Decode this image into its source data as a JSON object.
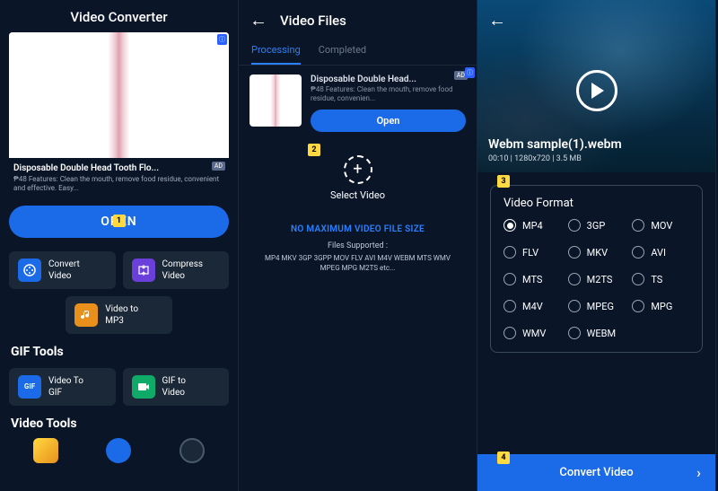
{
  "screens": {
    "home": {
      "title": "Video Converter",
      "ad": {
        "title": "Disposable Double Head Tooth Flo...",
        "desc": "₱48 Features: Clean the mouth, remove food residue, convenient and effective. Easy...",
        "open": "OPEN",
        "badge": "AD"
      },
      "tools": {
        "convert_video": "Convert\nVideo",
        "compress_video": "Compress\nVideo",
        "video_mp3": "Video to\nMP3"
      },
      "gif_tools_h": "GIF Tools",
      "gif_tools": {
        "video_to_gif": "Video To\nGIF",
        "gif_to_video": "GIF to\nVideo"
      },
      "video_tools_h": "Video Tools"
    },
    "files": {
      "title": "Video Files",
      "tabs": {
        "processing": "Processing",
        "completed": "Completed"
      },
      "ad": {
        "title": "Disposable Double Head...",
        "desc": "₱48 Features: Clean the mouth, remove food residue, convenien...",
        "open": "Open",
        "badge": "AD"
      },
      "select_video": "Select Video",
      "no_max": "NO MAXIMUM VIDEO FILE SIZE",
      "files_supported": "Files Supported :",
      "files_list": "MP4 MKV 3GP 3GPP MOV FLV AVI M4V WEBM MTS WMV MPEG MPG M2TS etc..."
    },
    "convert": {
      "filename": "Webm sample(1).webm",
      "meta_duration": "00:10",
      "meta_res": "1280x720",
      "meta_size": "3.5 MB",
      "format_h": "Video Format",
      "formats": [
        "MP4",
        "3GP",
        "MOV",
        "FLV",
        "MKV",
        "AVI",
        "MTS",
        "M2TS",
        "TS",
        "M4V",
        "MPEG",
        "MPG",
        "WMV",
        "WEBM"
      ],
      "selected": "MP4",
      "convert_btn": "Convert Video"
    }
  },
  "steps": {
    "s1": "1",
    "s2": "2",
    "s3": "3",
    "s4": "4"
  }
}
